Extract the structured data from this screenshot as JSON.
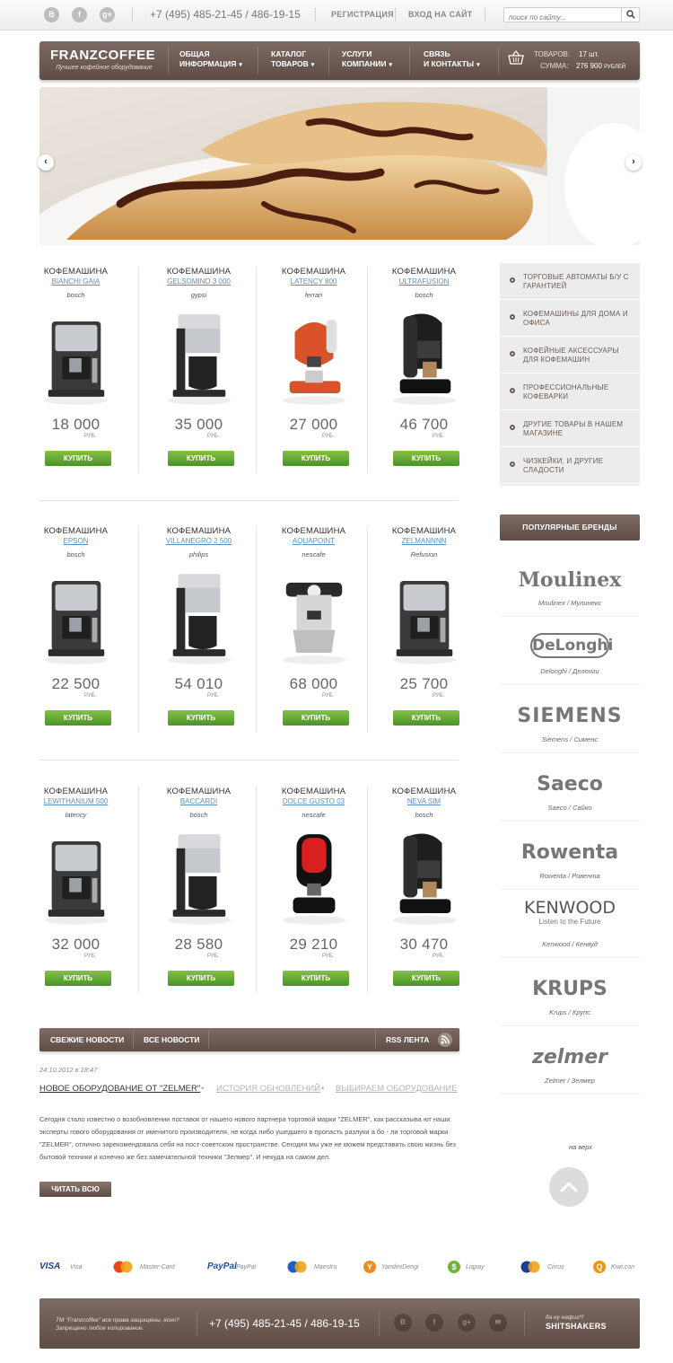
{
  "topbar": {
    "social": [
      "B",
      "f",
      "g+"
    ],
    "phone": "+7 (495) 485-21-45 / 486-19-15",
    "register": "РЕГИСТРАЦИЯ",
    "login": "ВХОД НА САЙТ",
    "search_placeholder": "поиск по сайту..."
  },
  "nav": {
    "logo": "FRANZCOFFEE",
    "logo_sub": "Лучшее кофейное оборудование",
    "items": [
      {
        "line1": "ОБЩАЯ",
        "line2": "ИНФОРМАЦИЯ"
      },
      {
        "line1": "КАТАЛОГ",
        "line2": "ТОВАРОВ"
      },
      {
        "line1": "УСЛУГИ",
        "line2": "КОМПАНИИ"
      },
      {
        "line1": "СВЯЗЬ",
        "line2": "И КОНТАКТЫ"
      }
    ],
    "cart": {
      "goods_label": "ТОВАРОВ:",
      "goods_value": "17 шт.",
      "sum_label": "СУММА:",
      "sum_value": "276 900",
      "sum_unit": "РУБЛЕЙ"
    }
  },
  "slider": {
    "prev": "‹",
    "next": "›"
  },
  "products": [
    {
      "category": "КОФЕМАШИНА",
      "name": "BIANCHI GAIA",
      "brand": "bosch",
      "price": "18 000",
      "currency": "РУБ.",
      "buy": "КУПИТЬ",
      "kind": "espresso-silver"
    },
    {
      "category": "КОФЕМАШИНА",
      "name": "GELSOMINO 3 000",
      "brand": "gypsi",
      "price": "35 000",
      "currency": "РУБ.",
      "buy": "КУПИТЬ",
      "kind": "drip"
    },
    {
      "category": "КОФЕМАШИНА",
      "name": "LATENCY 800",
      "brand": "ferrari",
      "price": "27 000",
      "currency": "РУБ.",
      "buy": "КУПИТЬ",
      "kind": "red-pod"
    },
    {
      "category": "КОФЕМАШИНА",
      "name": "ULTRAFUSION",
      "brand": "bosch",
      "price": "46 700",
      "currency": "РУБ.",
      "buy": "КУПИТЬ",
      "kind": "black-pod"
    },
    {
      "category": "КОФЕМАШИНА",
      "name": "EPSON",
      "brand": "bosch",
      "price": "22 500",
      "currency": "РУБ.",
      "buy": "КУПИТЬ",
      "kind": "espresso-silver"
    },
    {
      "category": "КОФЕМАШИНА",
      "name": "VILLANEGRO 2 500",
      "brand": "philips",
      "price": "54 010",
      "currency": "РУБ.",
      "buy": "КУПИТЬ",
      "kind": "drip"
    },
    {
      "category": "КОФЕМАШИНА",
      "name": "AQUAPOINT",
      "brand": "nescafe",
      "price": "68 000",
      "currency": "РУБ.",
      "buy": "КУПИТЬ",
      "kind": "classic"
    },
    {
      "category": "КОФЕМАШИНА",
      "name": "ZELMANNNN",
      "brand": "Refusion",
      "price": "25 700",
      "currency": "РУБ.",
      "buy": "КУПИТЬ",
      "kind": "espresso-silver"
    },
    {
      "category": "КОФЕМАШИНА",
      "name": "LEWITHANIUM 500",
      "brand": "latency",
      "price": "32 000",
      "currency": "РУБ.",
      "buy": "КУПИТЬ",
      "kind": "espresso-silver"
    },
    {
      "category": "КОФЕМАШИНА",
      "name": "BACCARDI",
      "brand": "bosch",
      "price": "28 580",
      "currency": "РУБ.",
      "buy": "КУПИТЬ",
      "kind": "drip"
    },
    {
      "category": "КОФЕМАШИНА",
      "name": "DOLCE GUSTO 03",
      "brand": "nescafe",
      "price": "29 210",
      "currency": "РУБ.",
      "buy": "КУПИТЬ",
      "kind": "red-black"
    },
    {
      "category": "КОФЕМАШИНА",
      "name": "NEVA SIM",
      "brand": "bosch",
      "price": "30 470",
      "currency": "РУБ.",
      "buy": "КУПИТЬ",
      "kind": "black-pod"
    }
  ],
  "categories": [
    {
      "label": "ТОРГОВЫЕ АВТОМАТЫ Б/У С ГАРАНТИЕЙ"
    },
    {
      "label": "КОФЕМАШИНЫ ДЛЯ ДОМА И ОФИСА"
    },
    {
      "label": "КОФЕЙНЫЕ АКСЕССУАРЫ ДЛЯ КОФЕМАШИН"
    },
    {
      "label": "ПРОФЕССИОНАЛЬНЫЕ КОФЕВАРКИ"
    },
    {
      "label": "ДРУГИЕ ТОВАРЫ В НАШЕМ МАГАЗИНЕ"
    },
    {
      "label": "ЧИЗКЕЙКИ, И ДРУГИЕ СЛАДОСТИ"
    }
  ],
  "brands": {
    "title": "ПОПУЛЯРНЫЕ БРЕНДЫ",
    "items": [
      {
        "logo": "Moulinex",
        "caption": "Moulinex / Мулинекс",
        "sub": ""
      },
      {
        "logo": "DeLonghi",
        "caption": "Delonghi / Делонги",
        "sub": ""
      },
      {
        "logo": "SIEMENS",
        "caption": "Siemens / Сименс",
        "sub": ""
      },
      {
        "logo": "Saeco",
        "caption": "Saeco / Сайко",
        "sub": ""
      },
      {
        "logo": "Rowenta",
        "caption": "Rowenta / Ровента",
        "sub": ""
      },
      {
        "logo": "KENWOOD",
        "caption": "Kenwood / Кенвуд",
        "sub": "Listen to the Future"
      },
      {
        "logo": "KRUPS",
        "caption": "Krups / Крупс",
        "sub": ""
      },
      {
        "logo": "zelmer",
        "caption": "Zelmer / Зелмер",
        "sub": ""
      }
    ]
  },
  "news": {
    "tab_fresh": "СВЕЖИЕ НОВОСТИ",
    "tab_all": "ВСЕ НОВОСТИ",
    "rss": "RSS ЛЕНТА",
    "date": "24.10.2012 в 18:47",
    "title_active": "НОВОЕ  ОБОРУДОВАНИЕ ОТ \"ZELMER\"",
    "title_2": "ИСТОРИЯ ОБНОВЛЕНИЙ",
    "title_3": "ВЫБИРАЕМ ОБОРУДОВАНИЕ",
    "dot": "•",
    "body": "Сегодня стало известно о возобновлении поставок от нашего нового партнера торговой марки  \"ZELMER\", как рассказыва ют наши эксперты гового оборудования от именитого производителя, не когда либо ушедшего в пропасть разлуки а бо - ли торговой марки \"ZELMER\", отлично зарекомендовала себя на пост-советском пространстве. Сегодня мы уже не можем представить свою жизнь без бытовой техники и конечно же без замечательной техники \"Зелмер\". И некуда на самом дел.",
    "read_all": "ЧИТАТЬ ВСЮ",
    "to_top": "на верх"
  },
  "payments": [
    {
      "mark": "VISA",
      "label": "Visa",
      "color": "#1a3e8c"
    },
    {
      "mark": "mc",
      "label": "Master-Card",
      "color": "#e8471c"
    },
    {
      "mark": "PayPal",
      "label": "PayPal",
      "color": "#1d4e9e"
    },
    {
      "mark": "mc",
      "label": "Maestro",
      "color": "#1f5fbf"
    },
    {
      "mark": "Y",
      "label": "YandexDengi",
      "color": "#f08a1c"
    },
    {
      "mark": "$",
      "label": "Liqpay",
      "color": "#6fb539"
    },
    {
      "mark": "mc",
      "label": "Cirrus",
      "color": "#1d3f8f"
    },
    {
      "mark": "Q",
      "label": "Kiwi.con",
      "color": "#f29313"
    }
  ],
  "footer": {
    "copyright": "ТМ \"Franzcoffee\" все права защищены, ясно? Запрещено любое копирование.",
    "phone": "+7 (495) 485-21-45 / 486-19-15",
    "social": [
      "B",
      "f",
      "g+",
      "✉"
    ],
    "made_by": "да ну нафиг!?",
    "studio": "SHITSHAKERS"
  }
}
